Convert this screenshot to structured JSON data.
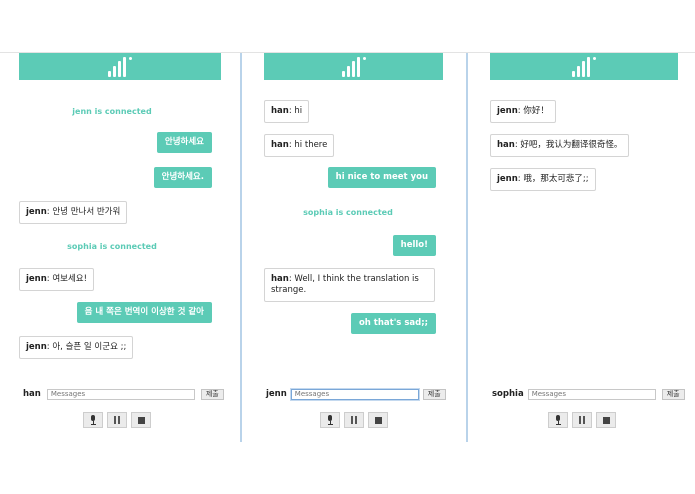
{
  "panels": [
    {
      "user": "han",
      "messages": [
        {
          "kind": "system",
          "text": "jenn is connected"
        },
        {
          "kind": "out",
          "text": "안녕하세요"
        },
        {
          "kind": "out",
          "text": "안녕하세요."
        },
        {
          "kind": "in",
          "sender": "jenn",
          "text": ": 안녕 만나서 반가워"
        },
        {
          "kind": "system",
          "text": "sophia is connected"
        },
        {
          "kind": "in",
          "sender": "jenn",
          "text": ": 여보세요!"
        },
        {
          "kind": "out",
          "text": "음 내 쪽은 번역이 이상한 것 같아"
        },
        {
          "kind": "in",
          "sender": "jenn",
          "text": ": 아, 슬픈 일 이군요 ;;"
        }
      ],
      "input": {
        "placeholder": "Messages",
        "value": ""
      },
      "submit_label": "제출"
    },
    {
      "user": "jenn",
      "messages": [
        {
          "kind": "in",
          "sender": "han",
          "text": ": hi"
        },
        {
          "kind": "in",
          "sender": "han",
          "text": ": hi there"
        },
        {
          "kind": "out",
          "text": "hi nice to meet you"
        },
        {
          "kind": "system",
          "text": "sophia is connected"
        },
        {
          "kind": "out",
          "text": "hello!"
        },
        {
          "kind": "in",
          "sender": "han",
          "text": ": Well, I think the translation is strange."
        },
        {
          "kind": "out",
          "text": "oh that's sad;;"
        }
      ],
      "input": {
        "placeholder": "Messages",
        "value": ""
      },
      "submit_label": "제출"
    },
    {
      "user": "sophia",
      "messages": [
        {
          "kind": "in",
          "sender": "jenn",
          "text": ": 你好！"
        },
        {
          "kind": "in",
          "sender": "han",
          "text": ": 好吧，我认为翻译很奇怪。"
        },
        {
          "kind": "in",
          "sender": "jenn",
          "text": ": 哦，那太可悲了;;"
        }
      ],
      "input": {
        "placeholder": "Messages",
        "value": ""
      },
      "submit_label": "제출"
    }
  ],
  "controls": [
    "mic-icon",
    "pause-icon",
    "stop-icon"
  ],
  "colors": {
    "accent": "#5ccbb6",
    "divider": "#b9d3ea"
  }
}
